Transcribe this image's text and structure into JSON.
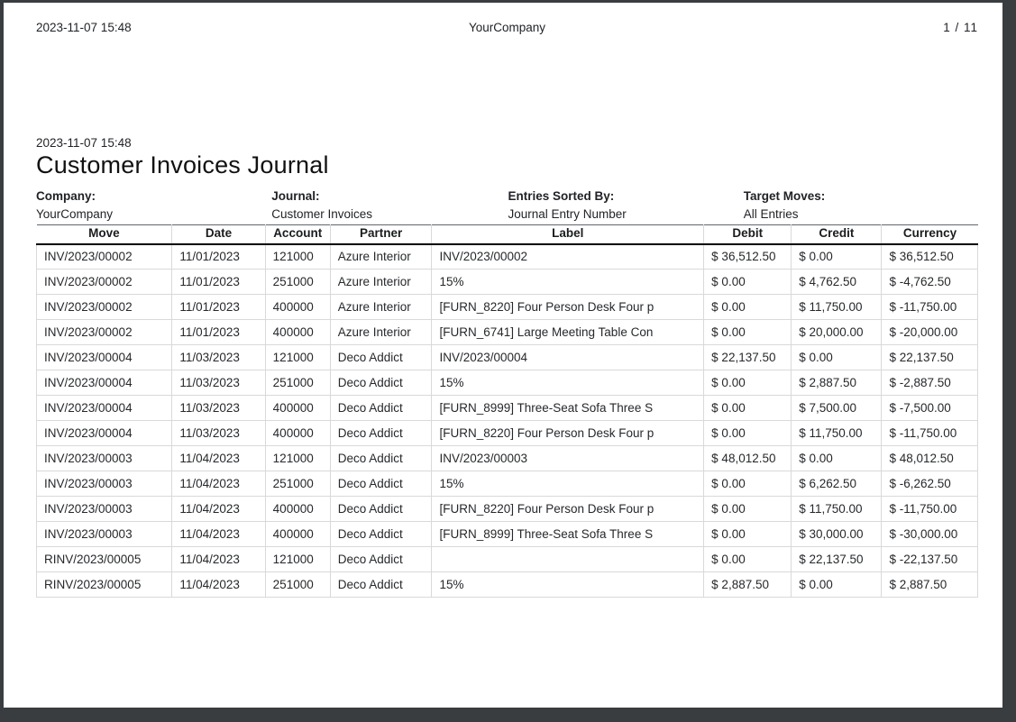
{
  "colors": {
    "viewer_background": "#3a3d40",
    "page_background": "#ffffff",
    "header_rule": "#000000",
    "cell_border": "#d9d9d9"
  },
  "page_header": {
    "datetime": "2023-11-07 15:48",
    "company": "YourCompany",
    "page_display": "1 / 11"
  },
  "report": {
    "datetime": "2023-11-07 15:48",
    "title": "Customer Invoices Journal",
    "meta": [
      {
        "label": "Company:",
        "value": "YourCompany"
      },
      {
        "label": "Journal:",
        "value": "Customer Invoices"
      },
      {
        "label": "Entries Sorted By:",
        "value": "Journal Entry Number"
      },
      {
        "label": "Target Moves:",
        "value": "All Entries"
      }
    ]
  },
  "table": {
    "columns": [
      "Move",
      "Date",
      "Account",
      "Partner",
      "Label",
      "Debit",
      "Credit",
      "Currency"
    ],
    "column_keys": [
      "move",
      "date",
      "account",
      "partner",
      "label",
      "debit",
      "credit",
      "currency"
    ],
    "rows": [
      [
        "INV/2023/00002",
        "11/01/2023",
        "121000",
        "Azure Interior",
        "INV/2023/00002",
        "$ 36,512.50",
        "$ 0.00",
        "$ 36,512.50"
      ],
      [
        "INV/2023/00002",
        "11/01/2023",
        "251000",
        "Azure Interior",
        "15%",
        "$ 0.00",
        "$ 4,762.50",
        "$ -4,762.50"
      ],
      [
        "INV/2023/00002",
        "11/01/2023",
        "400000",
        "Azure Interior",
        "[FURN_8220] Four Person Desk Four p",
        "$ 0.00",
        "$ 11,750.00",
        "$ -11,750.00"
      ],
      [
        "INV/2023/00002",
        "11/01/2023",
        "400000",
        "Azure Interior",
        "[FURN_6741] Large Meeting Table Con",
        "$ 0.00",
        "$ 20,000.00",
        "$ -20,000.00"
      ],
      [
        "INV/2023/00004",
        "11/03/2023",
        "121000",
        "Deco Addict",
        "INV/2023/00004",
        "$ 22,137.50",
        "$ 0.00",
        "$ 22,137.50"
      ],
      [
        "INV/2023/00004",
        "11/03/2023",
        "251000",
        "Deco Addict",
        "15%",
        "$ 0.00",
        "$ 2,887.50",
        "$ -2,887.50"
      ],
      [
        "INV/2023/00004",
        "11/03/2023",
        "400000",
        "Deco Addict",
        "[FURN_8999] Three-Seat Sofa Three S",
        "$ 0.00",
        "$ 7,500.00",
        "$ -7,500.00"
      ],
      [
        "INV/2023/00004",
        "11/03/2023",
        "400000",
        "Deco Addict",
        "[FURN_8220] Four Person Desk Four p",
        "$ 0.00",
        "$ 11,750.00",
        "$ -11,750.00"
      ],
      [
        "INV/2023/00003",
        "11/04/2023",
        "121000",
        "Deco Addict",
        "INV/2023/00003",
        "$ 48,012.50",
        "$ 0.00",
        "$ 48,012.50"
      ],
      [
        "INV/2023/00003",
        "11/04/2023",
        "251000",
        "Deco Addict",
        "15%",
        "$ 0.00",
        "$ 6,262.50",
        "$ -6,262.50"
      ],
      [
        "INV/2023/00003",
        "11/04/2023",
        "400000",
        "Deco Addict",
        "[FURN_8220] Four Person Desk Four p",
        "$ 0.00",
        "$ 11,750.00",
        "$ -11,750.00"
      ],
      [
        "INV/2023/00003",
        "11/04/2023",
        "400000",
        "Deco Addict",
        "[FURN_8999] Three-Seat Sofa Three S",
        "$ 0.00",
        "$ 30,000.00",
        "$ -30,000.00"
      ],
      [
        "RINV/2023/00005",
        "11/04/2023",
        "121000",
        "Deco Addict",
        "",
        "$ 0.00",
        "$ 22,137.50",
        "$ -22,137.50"
      ],
      [
        "RINV/2023/00005",
        "11/04/2023",
        "251000",
        "Deco Addict",
        "15%",
        "$ 2,887.50",
        "$ 0.00",
        "$ 2,887.50"
      ]
    ]
  }
}
